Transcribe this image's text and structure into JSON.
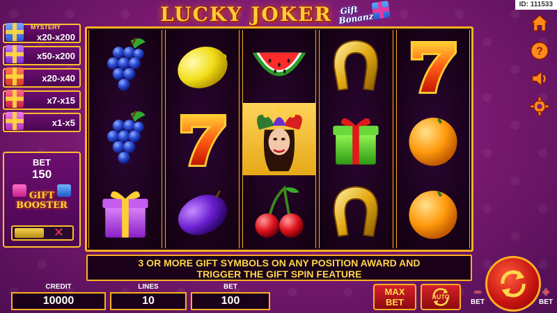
{
  "header": {
    "title": "LUCKY JOKER",
    "logo_line1": "Gift",
    "logo_line2": "Bonanza",
    "id_label": "ID: 111533"
  },
  "jackpots": {
    "mystery_label": "MYSTERY",
    "items": [
      {
        "value": "x20-x200",
        "color": "#4c7dff"
      },
      {
        "value": "x50-x200",
        "color": "#a64cff"
      },
      {
        "value": "x20-x40",
        "color": "#e6392a"
      },
      {
        "value": "x7-x15",
        "color": "#e63a57"
      },
      {
        "value": "x1-x5",
        "color": "#d84cd8"
      }
    ]
  },
  "bet_panel": {
    "label": "BET",
    "value": "150",
    "booster_line1": "GIFT",
    "booster_line2": "BOOSTER",
    "toggle_off": "✕"
  },
  "reels": [
    [
      "grapes",
      "grapes",
      "gift-purple"
    ],
    [
      "lemon",
      "seven",
      "plum"
    ],
    [
      "watermelon",
      "joker",
      "cherries"
    ],
    [
      "horseshoe",
      "gift-green",
      "horseshoe"
    ],
    [
      "seven",
      "orange",
      "orange"
    ]
  ],
  "message": {
    "line1": "3 OR MORE GIFT SYMBOLS ON ANY POSITION AWARD AND",
    "line2": "TRIGGER THE GIFT SPIN FEATURE"
  },
  "footer": {
    "credit_label": "CREDIT",
    "credit_value": "10000",
    "lines_label": "LINES",
    "lines_value": "10",
    "bet_label": "BET",
    "bet_value": "100",
    "maxbet_line1": "MAX",
    "maxbet_line2": "BET",
    "auto_label": "AUTO",
    "bet_minus_symbol": "−",
    "bet_minus_label": "BET",
    "bet_plus_symbol": "+",
    "bet_plus_label": "BET"
  },
  "side_icons": [
    "home-icon",
    "help-icon",
    "sound-icon",
    "settings-icon"
  ],
  "colors": {
    "accent_gold": "#ffb11f",
    "message_text": "#ffd84a",
    "background": "#7f1b74"
  }
}
